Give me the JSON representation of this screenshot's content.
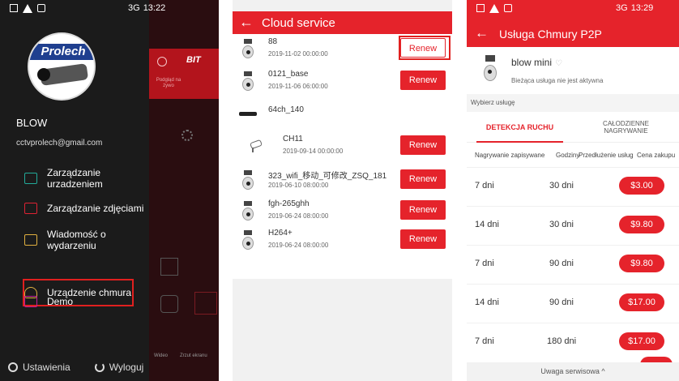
{
  "panel1": {
    "status": {
      "network": "3G",
      "time": "13:22"
    },
    "header": {
      "brand_text": "Prolech",
      "name": "BLOW",
      "email": "cctvprolech@gmail.com"
    },
    "menu": [
      {
        "label": "Zarządzanie urzadzeniem",
        "icon": "camera-icon"
      },
      {
        "label": "Zarządzanie zdjęciami",
        "icon": "photo-icon"
      },
      {
        "label": "Wiadomość o wydarzeniu",
        "icon": "message-icon"
      },
      {
        "label": "Urządzenie chmura",
        "icon": "cloud-icon"
      },
      {
        "label": "Demo",
        "icon": "demo-icon"
      }
    ],
    "footer": {
      "settings_label": "Ustawienia",
      "logout_label": "Wyloguj"
    },
    "background_app": {
      "logo_text": "BIT",
      "tab_label": "Podgląd na żywo",
      "video_label": "Wideo",
      "screenshot_label": "Zrzut ekranu"
    }
  },
  "panel2": {
    "title": "Cloud service",
    "renew_label": "Renew",
    "devices": [
      {
        "name": "88",
        "date": "2019-11-02 00:00:00",
        "type": "bullet",
        "renew": true,
        "highlighted": true
      },
      {
        "name": "0121_base",
        "date": "2019-11-06 06:00:00",
        "type": "bullet",
        "renew": true
      },
      {
        "name": "64ch_140",
        "date": "",
        "type": "nvr",
        "renew": false
      },
      {
        "name": "CH11",
        "date": "2019-09-14 00:00:00",
        "type": "dome",
        "renew": true
      },
      {
        "name": "323_wifi_移动_可修改_ZSQ_181",
        "date": "2019-06-10 08:00:00",
        "type": "bullet",
        "renew": true
      },
      {
        "name": "fgh-265ghh",
        "date": "2019-06-24 08:00:00",
        "type": "bullet",
        "renew": true
      },
      {
        "name": "H264+",
        "date": "2019-06-24 08:00:00",
        "type": "bullet",
        "renew": true
      }
    ]
  },
  "panel3": {
    "status": {
      "network": "3G",
      "time": "13:29"
    },
    "title": "Usługa Chmury P2P",
    "device": {
      "name": "blow mini",
      "status": "Bieżąca usługa nie jest aktywna"
    },
    "choose_label": "Wybierz usługę",
    "tabs": [
      "DETEKCJA RUCHU",
      "CAŁODZIENNE NAGRYWANIE"
    ],
    "columns": [
      "Nagrywanie zapisywane",
      "Godziny",
      "Przedłużenie usług",
      "Cena zakupu"
    ],
    "plans": [
      {
        "record": "7 dni",
        "duration": "30 dni",
        "price": "$3.00"
      },
      {
        "record": "14 dni",
        "duration": "30 dni",
        "price": "$9.80"
      },
      {
        "record": "7 dni",
        "duration": "90 dni",
        "price": "$9.80"
      },
      {
        "record": "14 dni",
        "duration": "90 dni",
        "price": "$17.00"
      },
      {
        "record": "7 dni",
        "duration": "180 dni",
        "price": "$17.00"
      }
    ],
    "notice": "Uwaga serwisowa ^"
  },
  "colors": {
    "accent": "#e5232b",
    "dark_bg": "#1b1b1b",
    "highlight": "#e0201f"
  }
}
